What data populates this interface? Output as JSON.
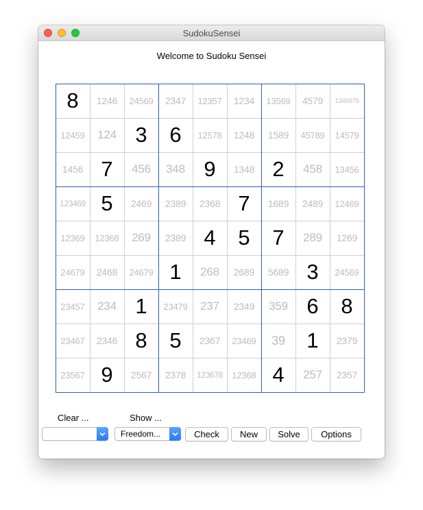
{
  "window": {
    "title": "SudokuSensei"
  },
  "header": {
    "welcome": "Welcome to Sudoku Sensei"
  },
  "board": {
    "cells": [
      [
        "8",
        "1246",
        "24569",
        "2347",
        "12357",
        "1234",
        "13569",
        "4579",
        "1345679"
      ],
      [
        "12459",
        "124",
        "3",
        "6",
        "12578",
        "1248",
        "1589",
        "45789",
        "14579"
      ],
      [
        "1456",
        "7",
        "456",
        "348",
        "9",
        "1348",
        "2",
        "458",
        "13456"
      ],
      [
        "123469",
        "5",
        "2469",
        "2389",
        "2368",
        "7",
        "1689",
        "2489",
        "12469"
      ],
      [
        "12369",
        "12368",
        "269",
        "2389",
        "4",
        "5",
        "7",
        "289",
        "1269"
      ],
      [
        "24679",
        "2468",
        "24679",
        "1",
        "268",
        "2689",
        "5689",
        "3",
        "24569"
      ],
      [
        "23457",
        "234",
        "1",
        "23479",
        "237",
        "2349",
        "359",
        "6",
        "8"
      ],
      [
        "23467",
        "2346",
        "8",
        "5",
        "2367",
        "23469",
        "39",
        "1",
        "2379"
      ],
      [
        "23567",
        "9",
        "2567",
        "2378",
        "123678",
        "12368",
        "4",
        "257",
        "2357"
      ]
    ]
  },
  "controls": {
    "clear_label": "Clear ...",
    "show_label": "Show ...",
    "clear_value": "",
    "show_value": "Freedom...",
    "check_label": "Check",
    "new_label": "New",
    "solve_label": "Solve",
    "options_label": "Options"
  },
  "colors": {
    "box_border": "#2a5bbf",
    "cell_border": "#cfcfcf",
    "given_digit": "#000000",
    "candidate_digit": "#bcbcbc",
    "accent": "#2a78f5"
  }
}
